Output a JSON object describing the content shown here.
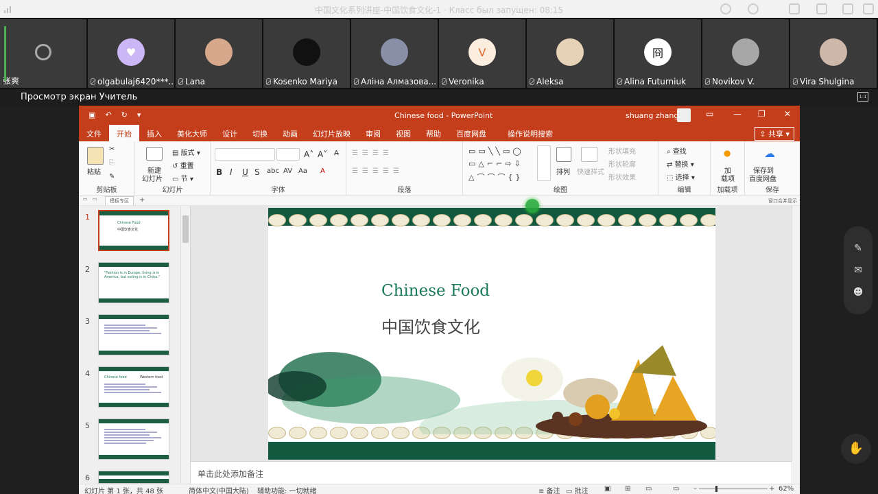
{
  "meeting": {
    "title": "中国文化系列讲座-中国饮食文化-1 · Класс был запущен: 08:15",
    "share_label": "Просмотр экран Учитель",
    "fit_label": "1:1"
  },
  "participants": [
    {
      "name": "张爽",
      "avatar": "",
      "bg": "#3a3a3a"
    },
    {
      "name": "olgabulaj6420***...",
      "avatar": "♥",
      "bg": "#cdb6f5"
    },
    {
      "name": "Lana",
      "avatar": "",
      "bg": "#d8a88c"
    },
    {
      "name": "Kosenko Mariya",
      "avatar": "",
      "bg": "#111111"
    },
    {
      "name": "Аліна Алмазова...",
      "avatar": "",
      "bg": "#8a8fa8"
    },
    {
      "name": "Veronika",
      "avatar": "V",
      "bg": "#fbeede"
    },
    {
      "name": "Aleksa",
      "avatar": "",
      "bg": "#e6d2b6"
    },
    {
      "name": "Alina Futurniuk",
      "avatar": "冏",
      "bg": "#ffffff"
    },
    {
      "name": "Novikov V.",
      "avatar": "",
      "bg": "#a7a7a7"
    },
    {
      "name": "Vira Shulgina",
      "avatar": "",
      "bg": "#cdb7a9"
    }
  ],
  "ppt": {
    "doc_title": "Chinese food  -  PowerPoint",
    "user": "shuang zhang",
    "tabs": [
      "文件",
      "开始",
      "插入",
      "美化大师",
      "设计",
      "切换",
      "动画",
      "幻灯片放映",
      "审阅",
      "视图",
      "帮助",
      "百度网盘",
      "操作说明搜索"
    ],
    "share": "共享",
    "groups": {
      "clipboard": "剪贴板",
      "paste": "粘贴",
      "slides": "幻灯片",
      "new_slide": "新建",
      "new_slide2": "幻灯片",
      "layout": "版式",
      "reset": "重置",
      "section": "节",
      "font": "字体",
      "paragraph": "段落",
      "drawing": "绘图",
      "arrange": "排列",
      "quick_styles": "快速样式",
      "shape_fill": "形状填充",
      "shape_outline": "形状轮廓",
      "shape_effect": "形状效果",
      "editing": "编辑",
      "find": "查找",
      "replace": "替换",
      "select": "选择",
      "addin": "加",
      "addin2": "载项",
      "addins": "加载项",
      "save_to": "保存到",
      "baidu": "百度网盘",
      "save": "保存"
    },
    "quickbar_tab": "模板专区",
    "quickbar_right": "窗口合并显示",
    "slide": {
      "title_en": "Chinese Food",
      "title_cn": "中国饮食文化"
    },
    "thumbs": [
      {
        "num": "1",
        "title": "Chinese Food",
        "sub": "中国饮食文化"
      },
      {
        "num": "2",
        "title": "\"Fashion is in Europe, living is in America, but eating is in China.\"",
        "sub": ""
      },
      {
        "num": "3",
        "title": "",
        "sub": ""
      },
      {
        "num": "4",
        "title": "Chinese food",
        "sub": "Western food"
      },
      {
        "num": "5",
        "title": "",
        "sub": ""
      },
      {
        "num": "6",
        "title": "",
        "sub": ""
      }
    ],
    "notes": "单击此处添加备注",
    "status": {
      "slide": "幻灯片 第 1 张，共 48 张",
      "lang": "简体中文(中国大陆)",
      "access": "辅助功能: 一切就绪",
      "notes": "备注",
      "comments": "批注",
      "zoom": "62%",
      "zoom_level": 0.62
    }
  },
  "colors": {
    "ppt_red": "#c43e1c",
    "slide_green": "#115a3f",
    "title_teal": "#1a7a5a"
  }
}
